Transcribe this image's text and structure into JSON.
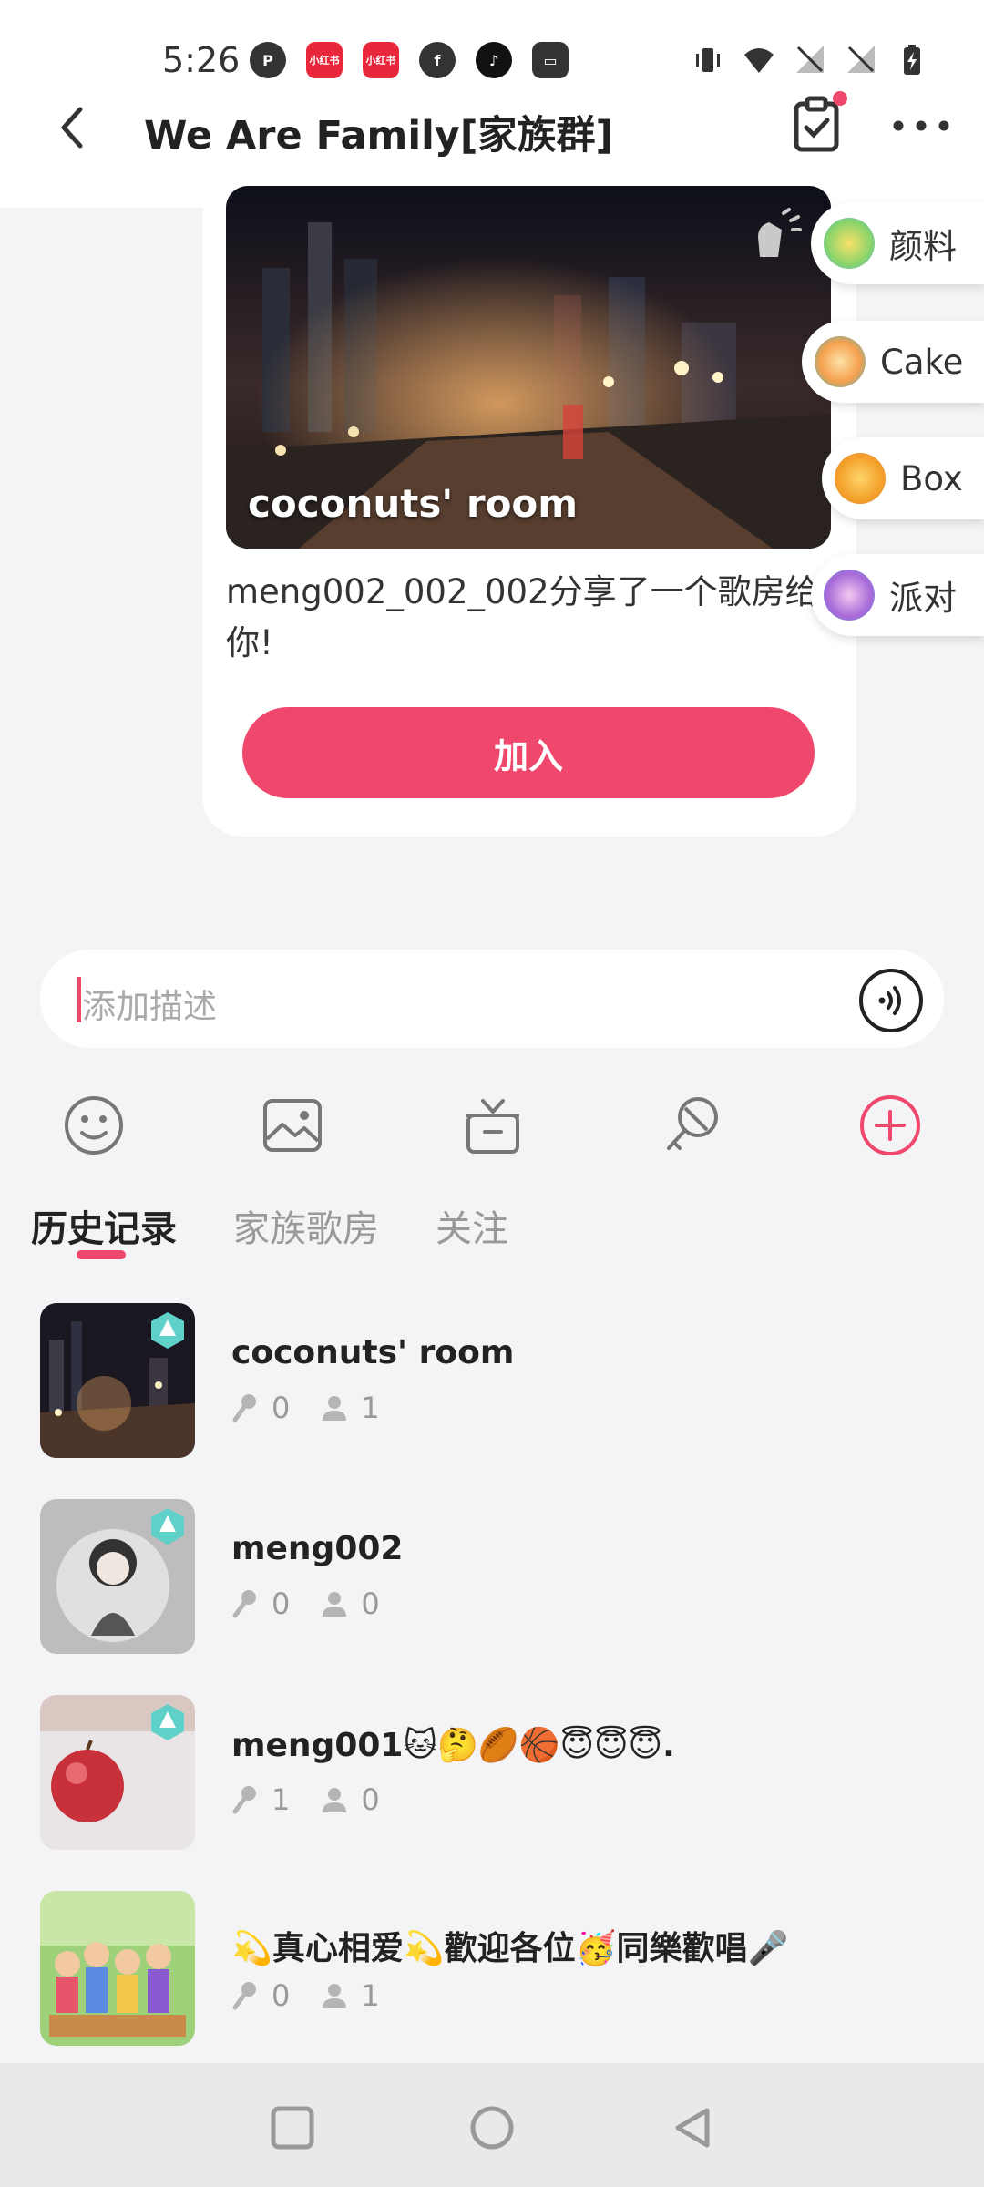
{
  "status": {
    "time": "5:26",
    "left_icons": [
      {
        "name": "p-app-icon",
        "bg": "#333333",
        "text": "P"
      },
      {
        "name": "xiaohongshu-icon",
        "bg": "#e8273a",
        "text": "小红书"
      },
      {
        "name": "xiaohongshu-icon-2",
        "bg": "#e8273a",
        "text": "小红书"
      },
      {
        "name": "facebook-icon",
        "bg": "#333333",
        "text": "f"
      },
      {
        "name": "tiktok-icon",
        "bg": "#111111",
        "text": "♪"
      },
      {
        "name": "wallet-icon",
        "bg": "#333333",
        "text": "▭"
      }
    ],
    "right_icons": [
      "vibrate-icon",
      "wifi-icon",
      "no-signal-icon",
      "no-signal-icon-2",
      "battery-charging-icon"
    ]
  },
  "header": {
    "title": "We Are Family[家族群]",
    "back_icon": "chevron-left-icon",
    "task_icon": "clipboard-check-icon",
    "more_icon": "more-horizontal-icon"
  },
  "share_card": {
    "room_name": "coconuts' room",
    "message": "meng002_002_002分享了一个歌房给你!",
    "join_label": "加入",
    "shake_icon": "shake-hand-icon"
  },
  "float_items": [
    {
      "label": "颜料",
      "icon": "paint-icon",
      "color": "#8bd46a"
    },
    {
      "label": "Cake",
      "icon": "cake-icon",
      "color": "#f6a04d"
    },
    {
      "label": "Box",
      "icon": "box-icon",
      "color": "#f3a12a"
    },
    {
      "label": "派对",
      "icon": "party-popper-icon",
      "color": "#a86ad8"
    }
  ],
  "input": {
    "placeholder": "添加描述",
    "voice_icon": "voice-wave-icon"
  },
  "toolbar": [
    "emoji-icon",
    "image-icon",
    "gift-icon",
    "microphone-off-icon",
    "plus-circle-icon"
  ],
  "tabs": {
    "items": [
      "历史记录",
      "家族歌房",
      "关注"
    ],
    "active": 0
  },
  "rooms": [
    {
      "title": "coconuts' room",
      "mic_count": "0",
      "user_count": "1",
      "thumb": "city-night"
    },
    {
      "title": "meng002",
      "mic_count": "0",
      "user_count": "0",
      "thumb": "gray-portrait"
    },
    {
      "title": "meng001🐱🤔🏉🏀😇😇😇.",
      "mic_count": "1",
      "user_count": "0",
      "thumb": "apple"
    },
    {
      "title": "💫真心相爱💫歡迎各位🥳同樂歡唱🎤",
      "mic_count": "0",
      "user_count": "1",
      "thumb": "family-picnic"
    }
  ],
  "nav": [
    "square-icon",
    "circle-icon",
    "triangle-back-icon"
  ],
  "colors": {
    "accent": "#f0476d",
    "background": "#f4f4f6"
  }
}
